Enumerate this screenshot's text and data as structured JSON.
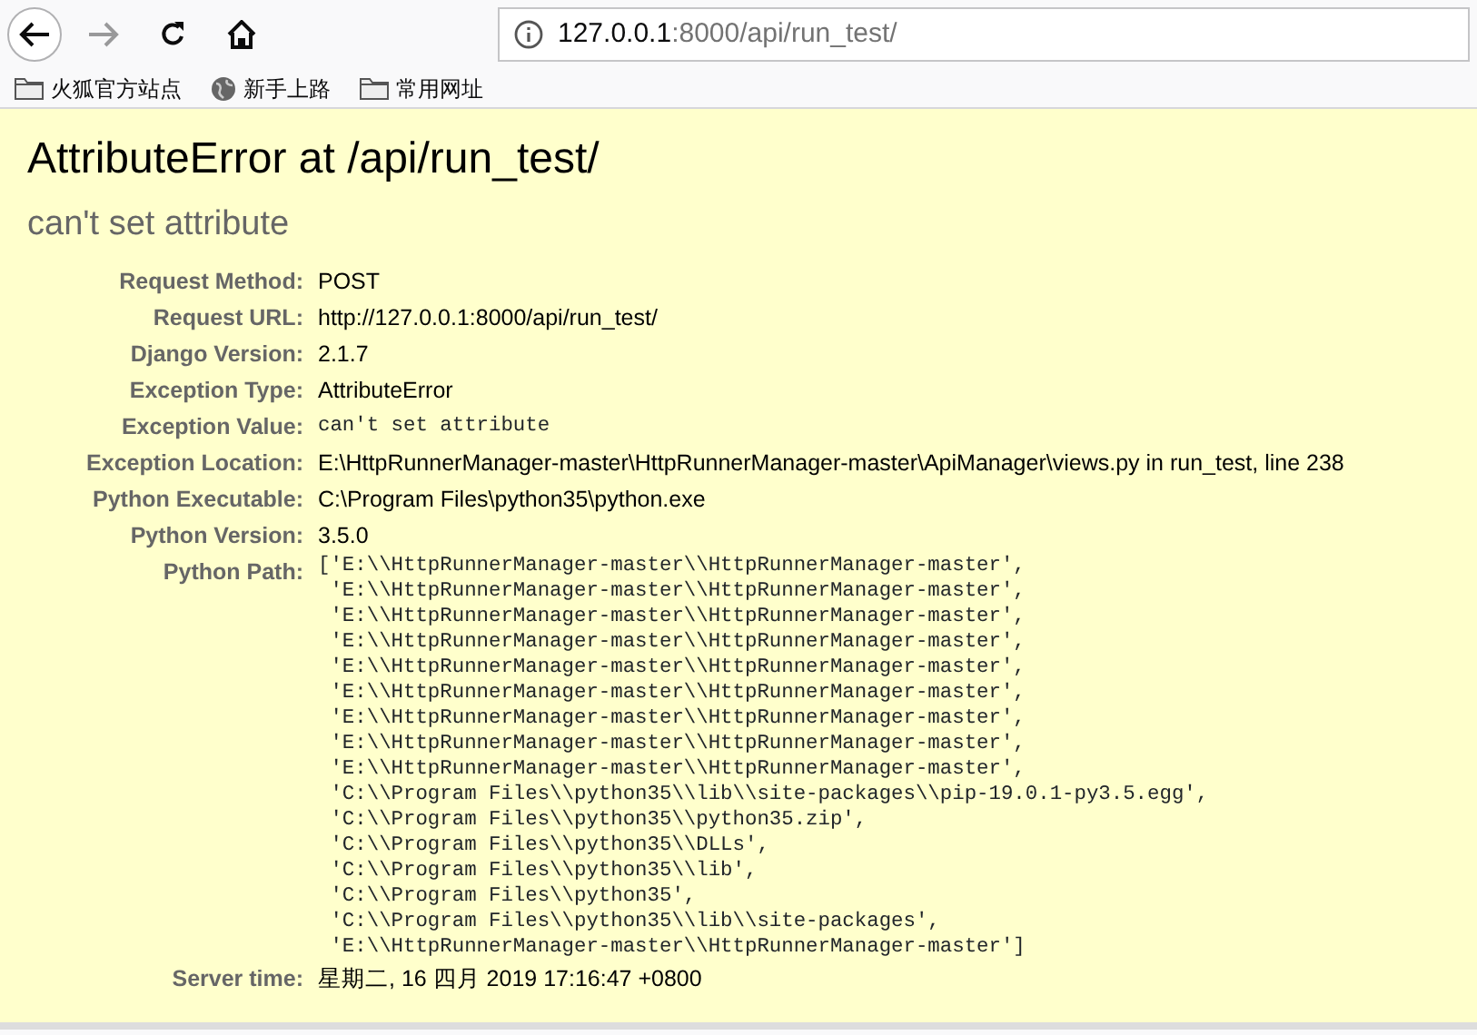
{
  "browser": {
    "url_host": "127.0.0.1",
    "url_path": ":8000/api/run_test/",
    "back_disabled": false,
    "forward_disabled": true
  },
  "bookmarks": [
    {
      "kind": "folder",
      "label": "火狐官方站点"
    },
    {
      "kind": "globe",
      "label": "新手上路"
    },
    {
      "kind": "folder",
      "label": "常用网址"
    }
  ],
  "page": {
    "title": "AttributeError at /api/run_test/",
    "subtitle": "can't set attribute",
    "rows": [
      {
        "kind": "text",
        "label": "Request Method:",
        "value": "POST"
      },
      {
        "kind": "text",
        "label": "Request URL:",
        "value": "http://127.0.0.1:8000/api/run_test/"
      },
      {
        "kind": "text",
        "label": "Django Version:",
        "value": "2.1.7"
      },
      {
        "kind": "text",
        "label": "Exception Type:",
        "value": "AttributeError"
      },
      {
        "kind": "code",
        "label": "Exception Value:",
        "value": "can't set attribute"
      },
      {
        "kind": "text",
        "label": "Exception Location:",
        "value": "E:\\HttpRunnerManager-master\\HttpRunnerManager-master\\ApiManager\\views.py in run_test, line 238"
      },
      {
        "kind": "text",
        "label": "Python Executable:",
        "value": "C:\\Program Files\\python35\\python.exe"
      },
      {
        "kind": "text",
        "label": "Python Version:",
        "value": "3.5.0"
      },
      {
        "kind": "lines",
        "label": "Python Path:",
        "lines": [
          "['E:\\\\HttpRunnerManager-master\\\\HttpRunnerManager-master',",
          " 'E:\\\\HttpRunnerManager-master\\\\HttpRunnerManager-master',",
          " 'E:\\\\HttpRunnerManager-master\\\\HttpRunnerManager-master',",
          " 'E:\\\\HttpRunnerManager-master\\\\HttpRunnerManager-master',",
          " 'E:\\\\HttpRunnerManager-master\\\\HttpRunnerManager-master',",
          " 'E:\\\\HttpRunnerManager-master\\\\HttpRunnerManager-master',",
          " 'E:\\\\HttpRunnerManager-master\\\\HttpRunnerManager-master',",
          " 'E:\\\\HttpRunnerManager-master\\\\HttpRunnerManager-master',",
          " 'E:\\\\HttpRunnerManager-master\\\\HttpRunnerManager-master',",
          " 'C:\\\\Program Files\\\\python35\\\\lib\\\\site-packages\\\\pip-19.0.1-py3.5.egg',",
          " 'C:\\\\Program Files\\\\python35\\\\python35.zip',",
          " 'C:\\\\Program Files\\\\python35\\\\DLLs',",
          " 'C:\\\\Program Files\\\\python35\\\\lib',",
          " 'C:\\\\Program Files\\\\python35',",
          " 'C:\\\\Program Files\\\\python35\\\\lib\\\\site-packages',",
          " 'E:\\\\HttpRunnerManager-master\\\\HttpRunnerManager-master']"
        ]
      },
      {
        "kind": "text",
        "label": "Server time:",
        "value": "星期二, 16 四月 2019 17:16:47 +0800"
      }
    ]
  }
}
